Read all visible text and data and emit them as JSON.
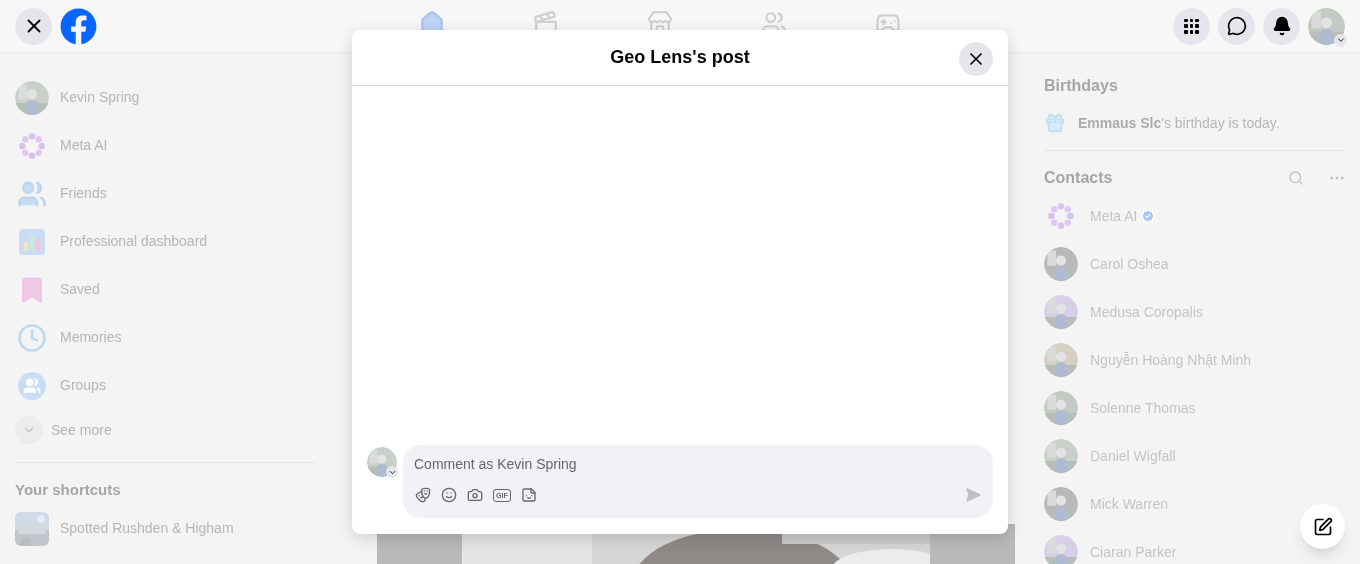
{
  "top_bar": {
    "nav": [
      {
        "kind": "home",
        "selected": true
      },
      {
        "kind": "video",
        "selected": false
      },
      {
        "kind": "marketplace",
        "selected": false
      },
      {
        "kind": "groups",
        "selected": false
      },
      {
        "kind": "gaming",
        "selected": false
      }
    ]
  },
  "sidebar": {
    "items": [
      {
        "kind": "profile",
        "label": "Kevin Spring"
      },
      {
        "kind": "meta",
        "label": "Meta AI"
      },
      {
        "kind": "friends",
        "label": "Friends"
      },
      {
        "kind": "dashboard",
        "label": "Professional dashboard"
      },
      {
        "kind": "saved",
        "label": "Saved"
      },
      {
        "kind": "memories",
        "label": "Memories"
      },
      {
        "kind": "groups",
        "label": "Groups"
      }
    ],
    "see_more": "See more",
    "shortcuts_title": "Your shortcuts",
    "shortcuts": [
      {
        "label": "Spotted Rushden & Higham"
      }
    ]
  },
  "birthdays": {
    "title": "Birthdays",
    "text": "**Emmaus Slc**'s birthday is today."
  },
  "contacts": {
    "title": "Contacts",
    "items": [
      {
        "kind": "meta",
        "name": "Meta AI",
        "verified": true
      },
      {
        "kind": "person",
        "name": "Carol Oshea",
        "verified": false
      },
      {
        "kind": "person",
        "name": "Medusa Coropalis",
        "verified": false
      },
      {
        "kind": "person",
        "name": "Nguyễn Hoàng Nhật Minh",
        "verified": false
      },
      {
        "kind": "person",
        "name": "Solenne Thomas",
        "verified": false
      },
      {
        "kind": "person",
        "name": "Daniel Wigfall",
        "verified": false
      },
      {
        "kind": "person",
        "name": "Mick Warren",
        "verified": false
      },
      {
        "kind": "person",
        "name": "Ciaran Parker",
        "verified": false
      }
    ]
  },
  "dialog": {
    "title": "Geo Lens's post",
    "comment": {
      "placeholder": "Comment as Kevin Spring",
      "tools": [
        {
          "kind": "avatar"
        },
        {
          "kind": "emoji"
        },
        {
          "kind": "camera"
        },
        {
          "kind": "gif",
          "label": "GIF"
        },
        {
          "kind": "sticker"
        }
      ]
    }
  }
}
